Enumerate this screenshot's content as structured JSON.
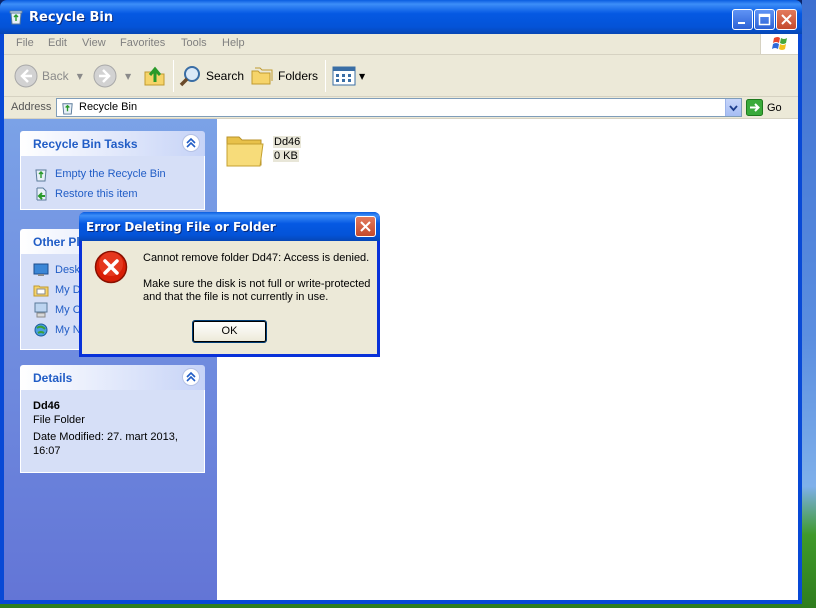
{
  "window": {
    "title": "Recycle Bin"
  },
  "menu": {
    "items": [
      "File",
      "Edit",
      "View",
      "Favorites",
      "Tools",
      "Help"
    ]
  },
  "toolbar": {
    "back_label": "Back",
    "search_label": "Search",
    "folders_label": "Folders"
  },
  "address": {
    "label": "Address",
    "value": "Recycle Bin",
    "go_label": "Go"
  },
  "sidebar": {
    "tasks_title": "Recycle Bin Tasks",
    "tasks": [
      "Empty the Recycle Bin",
      "Restore this item"
    ],
    "other_places_title": "Other Pl",
    "other_places": [
      "Desk",
      "My D",
      "My C",
      "My N"
    ],
    "details_title": "Details",
    "details_name": "Dd46",
    "details_type": "File Folder",
    "details_date_line1": "Date Modified: 27. mart 2013,",
    "details_date_line2": "16:07"
  },
  "files": [
    {
      "name": "Dd46",
      "size": "0 KB"
    }
  ],
  "dialog": {
    "title": "Error Deleting File or Folder",
    "message": "Cannot remove folder Dd47: Access is denied.",
    "detail_line1": "Make sure the disk is not full or write-protected",
    "detail_line2": "and that the file is not currently in use.",
    "ok_label": "OK"
  },
  "colors": {
    "xp_blue": "#0453d7",
    "task_link": "#215dc6",
    "dialog_bg": "#ece9d8",
    "error_red": "#d81e06"
  }
}
